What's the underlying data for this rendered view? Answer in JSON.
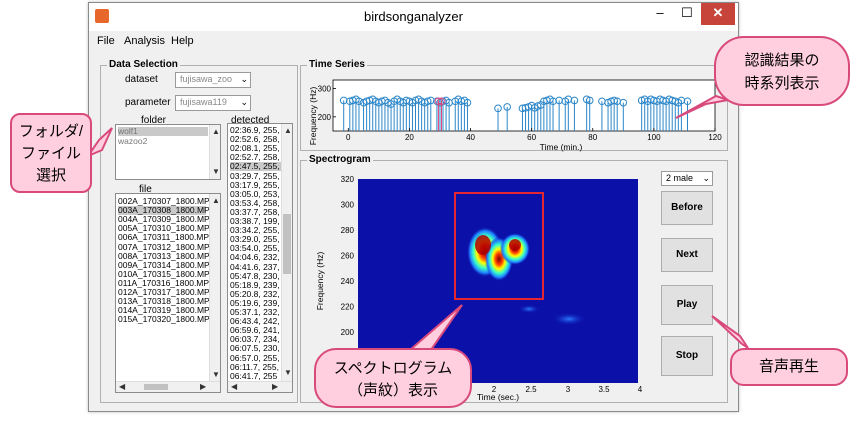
{
  "window": {
    "title": "birdsonganalyzer",
    "controls": {
      "minimize": "–",
      "maximize": "☐",
      "close": "✕"
    }
  },
  "menu": [
    "File",
    "Analysis",
    "Help"
  ],
  "data_selection": {
    "title": "Data Selection",
    "dataset_label": "dataset",
    "dataset_value": "fujisawa_zoo",
    "parameter_label": "parameter",
    "parameter_value": "fujisawa119",
    "folder_label": "folder",
    "folders": [
      "wolf1",
      "wazoo2"
    ],
    "detected_label": "detected",
    "detected": [
      "02:36.9, 255,",
      "02:52.6, 258,",
      "02:08.1, 255,",
      "02:52.7, 258,",
      "02:47.5, 255,",
      "03:29.7, 255,",
      "03:17.9, 255,",
      "03:05.0, 253,",
      "03:53.4, 258,",
      "03:37.7, 258,",
      "03:38.7, 199,",
      "03:34.2, 255,",
      "03:29.0, 255,",
      "03:54.0, 255,",
      "04:04.6, 232,",
      "04:41.6, 237,",
      "05:47.8, 230,",
      "05:18.9, 239,",
      "05:20.8, 232,",
      "05:19.6, 239,",
      "05:37.1, 232,",
      "06:43.4, 242,",
      "06:59.6, 241,",
      "06:03.7, 234,",
      "06:07.5, 230,",
      "06:57.0, 255,",
      "06:11.7, 255,",
      "06:41.7, 255"
    ],
    "detected_selected": 4,
    "file_label": "file",
    "files": [
      "002A_170307_1800.MP3",
      "003A_170308_1800.MP3",
      "004A_170309_1800.MP3",
      "005A_170310_1800.MP3",
      "006A_170311_1800.MP3",
      "007A_170312_1800.MP3",
      "008A_170313_1800.MP3",
      "009A_170314_1800.MP3",
      "010A_170315_1800.MP3",
      "011A_170316_1800.MP3",
      "012A_170317_1800.MP3",
      "013A_170318_1800.MP3",
      "014A_170319_1800.MP3",
      "015A_170320_1800.MP3"
    ],
    "file_selected": 1
  },
  "time_series": {
    "title": "Time Series",
    "ylabel": "Frequency (Hz)",
    "xlabel": "Time (min.)",
    "xticks": [
      0,
      20,
      40,
      60,
      80,
      100,
      120
    ],
    "yticks": [
      200,
      300
    ],
    "xlim": [
      -5,
      120
    ],
    "ylim": [
      150,
      330
    ],
    "color": "#2b86c9",
    "highlight_color": "#e0457b",
    "events": [
      [
        -1.5,
        258
      ],
      [
        0.5,
        255
      ],
      [
        1.5,
        258
      ],
      [
        2.5,
        262
      ],
      [
        3.5,
        255
      ],
      [
        5,
        250
      ],
      [
        6,
        255
      ],
      [
        7,
        258
      ],
      [
        8,
        262
      ],
      [
        9,
        255
      ],
      [
        10,
        250
      ],
      [
        11,
        255
      ],
      [
        12,
        258
      ],
      [
        13,
        250
      ],
      [
        14,
        245
      ],
      [
        15,
        255
      ],
      [
        16,
        262
      ],
      [
        17,
        255
      ],
      [
        18,
        250
      ],
      [
        19,
        258
      ],
      [
        20,
        255
      ],
      [
        21,
        250
      ],
      [
        22,
        258
      ],
      [
        23,
        262
      ],
      [
        24,
        255
      ],
      [
        25,
        250
      ],
      [
        26,
        255
      ],
      [
        27,
        258
      ],
      [
        29,
        255
      ],
      [
        30,
        250
      ],
      [
        31,
        255
      ],
      [
        32,
        258
      ],
      [
        33,
        250
      ],
      [
        35,
        255
      ],
      [
        36,
        262
      ],
      [
        37,
        255
      ],
      [
        38,
        258
      ],
      [
        39,
        250
      ],
      [
        49,
        230
      ],
      [
        52,
        235
      ],
      [
        57,
        230
      ],
      [
        58,
        232
      ],
      [
        59,
        235
      ],
      [
        60,
        240
      ],
      [
        61,
        232
      ],
      [
        62,
        238
      ],
      [
        63,
        242
      ],
      [
        64,
        255
      ],
      [
        65,
        258
      ],
      [
        66,
        262
      ],
      [
        67,
        255
      ],
      [
        69,
        258
      ],
      [
        71,
        255
      ],
      [
        72,
        262
      ],
      [
        74,
        258
      ],
      [
        78,
        262
      ],
      [
        79,
        258
      ],
      [
        83,
        255
      ],
      [
        85,
        250
      ],
      [
        86,
        255
      ],
      [
        87,
        258
      ],
      [
        88,
        255
      ],
      [
        90,
        250
      ],
      [
        96,
        258
      ],
      [
        97,
        262
      ],
      [
        98,
        255
      ],
      [
        99,
        262
      ],
      [
        100,
        258
      ],
      [
        101,
        255
      ],
      [
        102,
        262
      ],
      [
        103,
        258
      ],
      [
        104,
        255
      ],
      [
        105,
        262
      ],
      [
        106,
        258
      ],
      [
        107,
        255
      ],
      [
        108,
        250
      ],
      [
        109,
        258
      ],
      [
        111,
        255
      ]
    ],
    "highlight_events": [
      [
        29.5,
        255
      ],
      [
        30.5,
        255
      ]
    ]
  },
  "spectrogram": {
    "title": "Spectrogram",
    "ylabel": "Frequency (Hz)",
    "xlabel": "Time (sec.)",
    "yticks": [
      160,
      180,
      200,
      220,
      240,
      260,
      280,
      300,
      320
    ],
    "xticks_visible": [
      "2",
      "2.5",
      "3",
      "3.5",
      "4"
    ],
    "sex_value": "2 male",
    "highlight_box_color": "#e3262f"
  },
  "buttons": {
    "before": "Before",
    "next": "Next",
    "play": "Play",
    "stop": "Stop"
  },
  "callouts": {
    "folder_file": "フォルダ/\nファイル\n選択",
    "time_series": "認識結果の\n時系列表示",
    "spectrogram": "スペクトログラム\n（声紋）表示",
    "playback": "音声再生"
  }
}
